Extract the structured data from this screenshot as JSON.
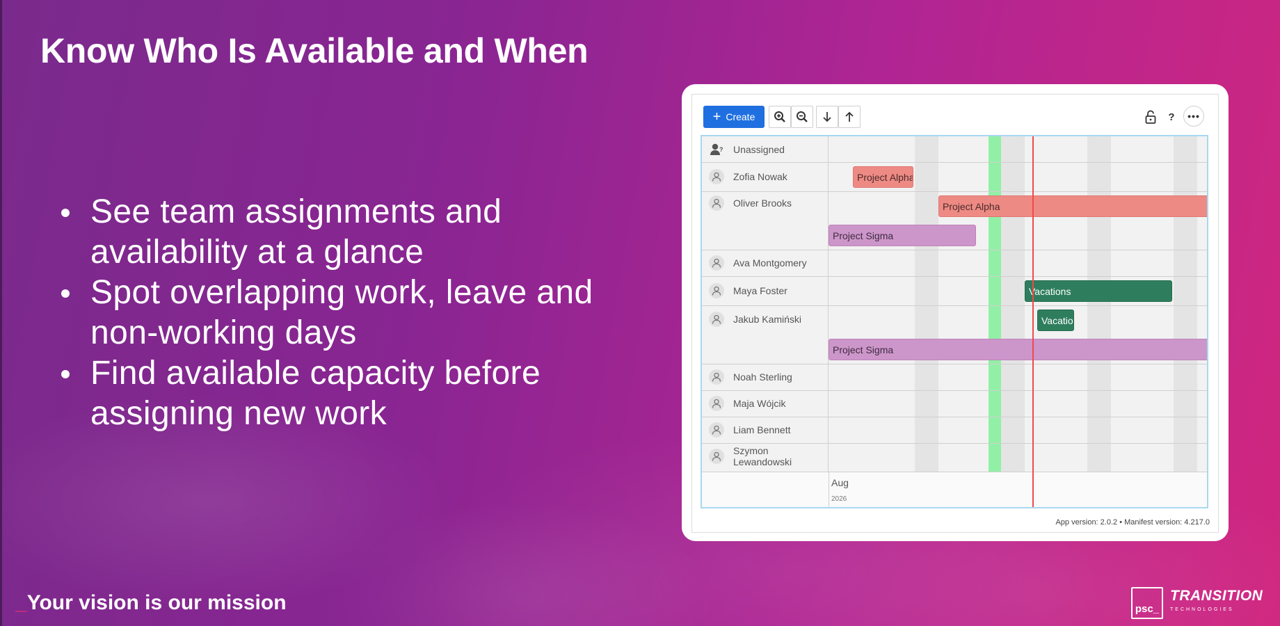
{
  "slide": {
    "title": "Know Who Is Available and When",
    "bullets": [
      "See team assignments and availability at a glance",
      "Spot overlapping work, leave and non-working days",
      "Find available capacity before assigning new work"
    ],
    "tagline_underscore": "_",
    "tagline": "Your vision is our mission",
    "logo_mark": "psc_",
    "logo_name": "TRANSITION",
    "logo_sub": "TECHNOLOGIES"
  },
  "app": {
    "toolbar": {
      "create_label": "Create",
      "help_label": "?",
      "more_label": "•••"
    },
    "resources": [
      {
        "name": "Unassigned",
        "icon": "unassigned-user-icon"
      },
      {
        "name": "Zofia Nowak",
        "icon": "user-icon"
      },
      {
        "name": "Oliver Brooks",
        "icon": "user-icon"
      },
      {
        "name": "Ava Montgomery",
        "icon": "user-icon"
      },
      {
        "name": "Maya Foster",
        "icon": "user-icon"
      },
      {
        "name": "Jakub Kamiński",
        "icon": "user-icon"
      },
      {
        "name": "Noah Sterling",
        "icon": "user-icon"
      },
      {
        "name": "Maja Wójcik",
        "icon": "user-icon"
      },
      {
        "name": "Liam Bennett",
        "icon": "user-icon"
      },
      {
        "name": "Szymon Lewandowski",
        "icon": "user-icon"
      }
    ],
    "events": [
      {
        "label": "Project Alpha",
        "resource": "Zofia Nowak",
        "type": "project-alpha"
      },
      {
        "label": "Project Alpha",
        "resource": "Oliver Brooks",
        "type": "project-alpha"
      },
      {
        "label": "Project Sigma",
        "resource": "Oliver Brooks",
        "type": "project-sigma"
      },
      {
        "label": "Vacations",
        "resource": "Maya Foster",
        "type": "vacation"
      },
      {
        "label": "Vacations",
        "resource": "Jakub Kamiński",
        "type": "vacation"
      },
      {
        "label": "Project Sigma",
        "resource": "Jakub Kamiński",
        "type": "project-sigma"
      }
    ],
    "axis": {
      "month": "Aug",
      "year": "2026"
    },
    "version_text": "App version: 2.0.2  •  Manifest version: 4.217.0",
    "colors": {
      "create_button": "#1f6fe0",
      "project_alpha": "#ee8a84",
      "project_sigma": "#cd96ca",
      "vacation": "#2e7e5e",
      "today_marker": "#ef4a4a",
      "highlight_day": "#92f0a6",
      "weekend": "#e4e4e4"
    }
  }
}
